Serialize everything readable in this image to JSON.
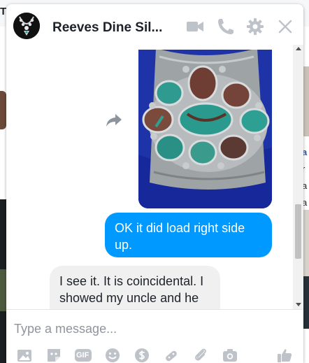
{
  "background": {
    "top_letter": "T",
    "right_texts": [
      "a",
      "r",
      "a",
      "a"
    ]
  },
  "chat": {
    "title": "Reeves Dine Sil...",
    "header_actions": [
      {
        "name": "video-call",
        "icon": "video-camera-icon"
      },
      {
        "name": "voice-call",
        "icon": "phone-icon"
      },
      {
        "name": "settings",
        "icon": "gear-icon"
      },
      {
        "name": "close",
        "icon": "close-icon"
      }
    ],
    "messages": {
      "photo": {
        "alt": "turquoise cluster silver bracelet",
        "icon": "share-arrow-icon"
      },
      "outgoing": "OK it did load right side up.",
      "incoming": "I see it. It is coincidental. I showed my uncle and he thought it was made"
    },
    "composer": {
      "placeholder": "Type a message...",
      "tools": [
        {
          "name": "photo",
          "icon": "image-icon"
        },
        {
          "name": "sticker",
          "icon": "sticker-icon"
        },
        {
          "name": "gif",
          "icon": "gif-icon",
          "label": "GIF"
        },
        {
          "name": "emoji",
          "icon": "smiley-icon"
        },
        {
          "name": "payment",
          "icon": "dollar-icon"
        },
        {
          "name": "game",
          "icon": "game-controller-icon"
        },
        {
          "name": "attach",
          "icon": "paperclip-icon"
        },
        {
          "name": "camera",
          "icon": "camera-icon"
        },
        {
          "name": "like",
          "icon": "thumbs-up-icon"
        }
      ]
    },
    "colors": {
      "accent": "#0099ff",
      "icon_gray": "#bec2c9",
      "incoming_bubble": "#f1f0f0"
    }
  }
}
